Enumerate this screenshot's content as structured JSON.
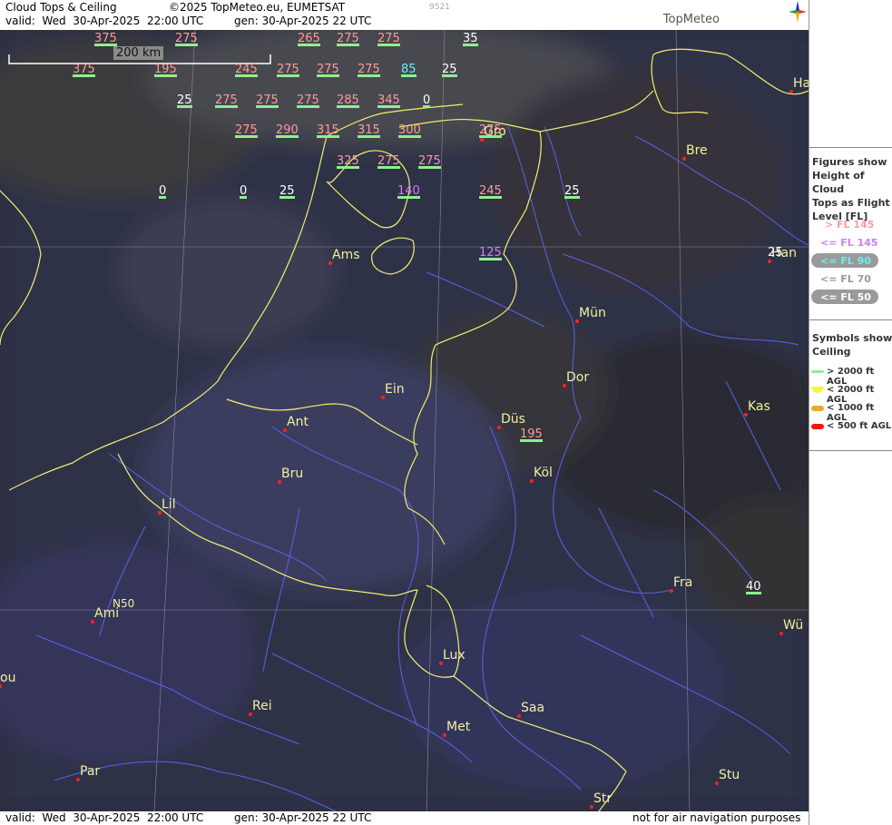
{
  "header": {
    "title": "Cloud Tops & Ceiling",
    "copyright": "©2025 TopMeteo.eu, EUMETSAT",
    "valid": "valid:  Wed  30-Apr-2025  22:00 UTC",
    "gen": "gen: 30-Apr-2025 22 UTC",
    "code": "9521",
    "brand": "TopMeteo"
  },
  "footer": {
    "valid": "valid:  Wed  30-Apr-2025  22:00 UTC",
    "gen": "gen: 30-Apr-2025 22 UTC",
    "disclaimer": "not for air navigation purposes"
  },
  "scale": {
    "label": "200 km"
  },
  "grid_label": "N50",
  "cities": [
    "Ha",
    "Gro",
    "Bre",
    "Ams",
    "Han",
    "Mün",
    "Ein",
    "Dor",
    "Ant",
    "Düs",
    "Kas",
    "Bru",
    "Köl",
    "Lil",
    "Fra",
    "Ami",
    "Wü",
    "ou",
    "Lux",
    "Rei",
    "Saa",
    "Met",
    "Par",
    "Stu",
    "Str"
  ],
  "flight_levels": [
    {
      "v": "375",
      "c": "pink"
    },
    {
      "v": "275",
      "c": "pink"
    },
    {
      "v": "265",
      "c": "pink"
    },
    {
      "v": "275",
      "c": "pink"
    },
    {
      "v": "275",
      "c": "pink"
    },
    {
      "v": "35",
      "c": "white"
    },
    {
      "v": "375",
      "c": "pink"
    },
    {
      "v": "195",
      "c": "pink"
    },
    {
      "v": "245",
      "c": "pink"
    },
    {
      "v": "275",
      "c": "pink"
    },
    {
      "v": "275",
      "c": "pink"
    },
    {
      "v": "275",
      "c": "pink"
    },
    {
      "v": "85",
      "c": "cyan"
    },
    {
      "v": "25",
      "c": "white"
    },
    {
      "v": "25",
      "c": "white"
    },
    {
      "v": "275",
      "c": "pink"
    },
    {
      "v": "275",
      "c": "pink"
    },
    {
      "v": "275",
      "c": "pink"
    },
    {
      "v": "285",
      "c": "pink"
    },
    {
      "v": "345",
      "c": "pink"
    },
    {
      "v": "0",
      "c": "white"
    },
    {
      "v": "275",
      "c": "pink"
    },
    {
      "v": "290",
      "c": "pink"
    },
    {
      "v": "315",
      "c": "pink"
    },
    {
      "v": "315",
      "c": "pink"
    },
    {
      "v": "300",
      "c": "pink"
    },
    {
      "v": "275",
      "c": "pink"
    },
    {
      "v": "325",
      "c": "pink"
    },
    {
      "v": "275",
      "c": "pink"
    },
    {
      "v": "275",
      "c": "pink"
    },
    {
      "v": "0",
      "c": "white"
    },
    {
      "v": "0",
      "c": "white"
    },
    {
      "v": "25",
      "c": "white"
    },
    {
      "v": "140",
      "c": "violet"
    },
    {
      "v": "245",
      "c": "pink"
    },
    {
      "v": "25",
      "c": "white"
    },
    {
      "v": "25",
      "c": "white"
    },
    {
      "v": "125",
      "c": "violet"
    },
    {
      "v": "195",
      "c": "pink"
    },
    {
      "v": "40",
      "c": "white"
    }
  ],
  "colors": {
    "pink": "#ff9a9a",
    "white": "#ffffff",
    "violet": "#d17df7",
    "cyan": "#66f0f0",
    "border": "#f2ef6e",
    "river": "#5a62e8",
    "grid": "#8a8a9a"
  },
  "legend": {
    "heading": [
      "Figures show",
      "Height of Cloud",
      "Tops as Flight",
      "Level  [FL]"
    ],
    "items": [
      "> FL 145",
      "<= FL 145",
      "<= FL 90",
      "<= FL 70",
      "<= FL 50"
    ],
    "symbols_heading": [
      "Symbols show",
      "Ceiling"
    ],
    "symbols": [
      {
        "label": "> 2000 ft AGL",
        "color": "#8ef08e"
      },
      {
        "label": "< 2000 ft AGL",
        "color": "#f4f44a"
      },
      {
        "label": "< 1000 ft AGL",
        "color": "#f5a623"
      },
      {
        "label": "< 500 ft AGL",
        "color": "#ff1010"
      }
    ]
  }
}
